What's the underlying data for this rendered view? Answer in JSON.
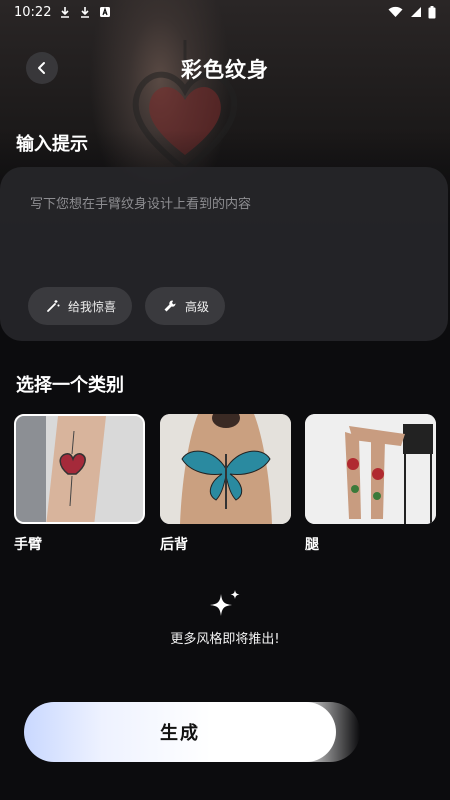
{
  "status_bar": {
    "time": "10:22",
    "icons_left": [
      "download-icon",
      "download-icon",
      "a-icon"
    ],
    "icons_right": [
      "wifi-icon",
      "signal-icon",
      "battery-icon"
    ]
  },
  "header": {
    "title": "彩色纹身",
    "back_icon": "chevron-left-icon"
  },
  "prompt_section": {
    "title": "输入提示",
    "placeholder": "写下您想在手臂纹身设计上看到的内容",
    "chips": [
      {
        "label": "给我惊喜",
        "icon": "magic-wand-icon"
      },
      {
        "label": "高级",
        "icon": "wrench-icon"
      }
    ]
  },
  "category_section": {
    "title": "选择一个类别",
    "items": [
      {
        "label": "手臂",
        "selected": true
      },
      {
        "label": "后背",
        "selected": false
      },
      {
        "label": "腿",
        "selected": false
      }
    ]
  },
  "more_styles": {
    "icon": "sparkle-icon",
    "text": "更多风格即将推出!"
  },
  "generate_button": {
    "label": "生成"
  },
  "colors": {
    "background": "#0c0c0e",
    "card": "#262629",
    "chip": "#3a3a3e",
    "button_gradient_start": "#c9d8ff",
    "button": "#ffffff"
  }
}
